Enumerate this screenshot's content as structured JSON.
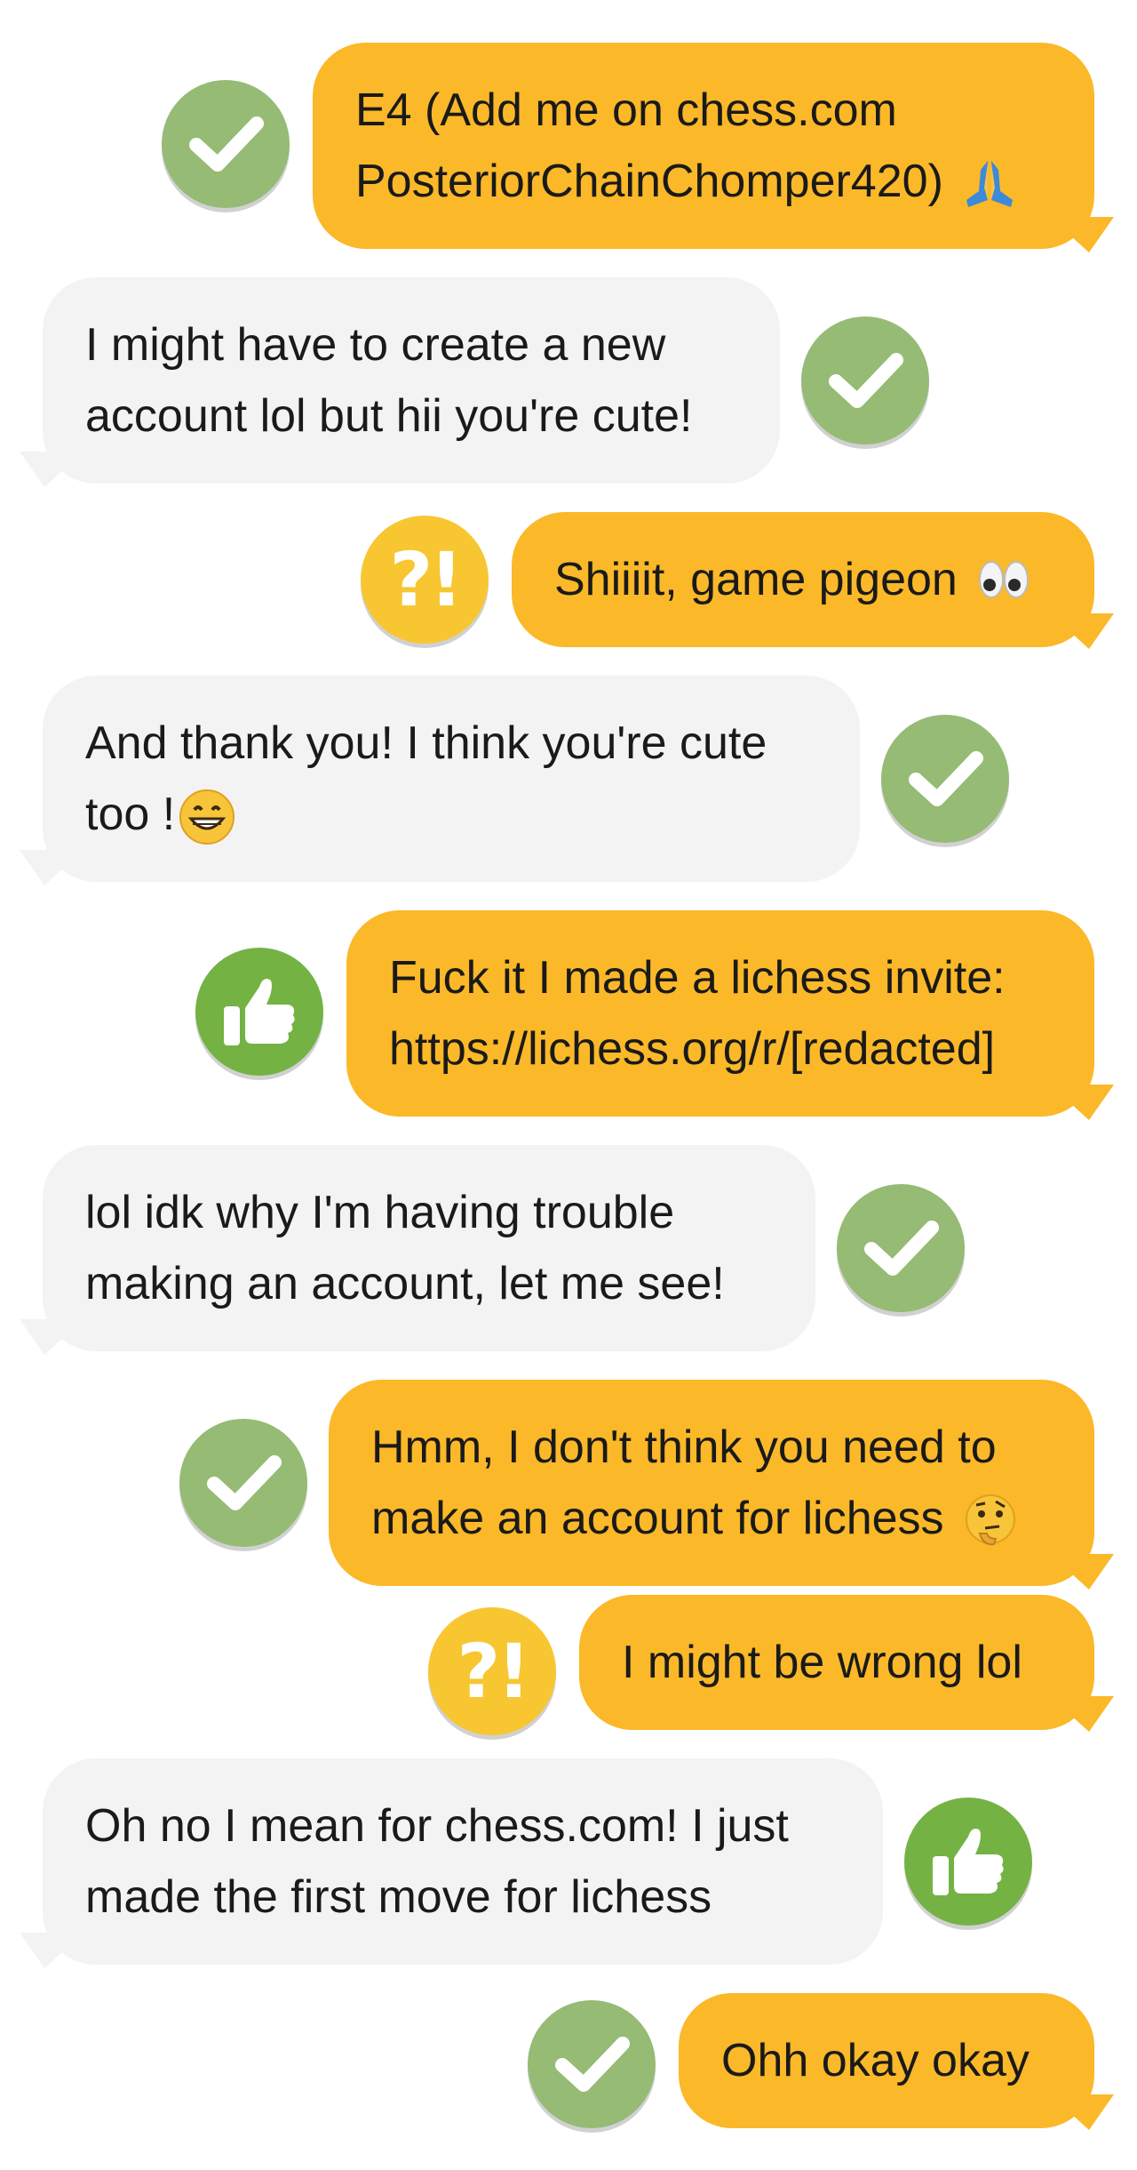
{
  "messages": [
    {
      "side": "out",
      "lines": [
        "E4 (Add me on chess.com",
        "PosteriorChainChomper420)"
      ],
      "emoji": "folded-hands-emoji",
      "badge": "best"
    },
    {
      "side": "in",
      "lines": [
        "I might have to create a new",
        "account lol but hii you're cute!"
      ],
      "badge": "best"
    },
    {
      "side": "out",
      "lines": [
        "Shiiiit, game pigeon"
      ],
      "emoji": "eyes-emoji",
      "badge": "interesting"
    },
    {
      "side": "in",
      "lines": [
        "And thank you! I think you're cute",
        "too !"
      ],
      "emoji": "grinning-face-emoji",
      "badge": "best"
    },
    {
      "side": "out",
      "lines": [
        "Fuck it I made a lichess invite:",
        "https://lichess.org/r/[redacted]"
      ],
      "badge": "great"
    },
    {
      "side": "in",
      "lines": [
        "lol idk why I'm having trouble",
        "making an account, let me see!"
      ],
      "badge": "best"
    },
    {
      "side": "out",
      "lines": [
        "Hmm, I don't think you need to",
        "make an account for lichess"
      ],
      "emoji": "thinking-face-emoji",
      "badge": "best"
    },
    {
      "side": "out",
      "lines": [
        "I might be wrong lol"
      ],
      "badge": "interesting"
    },
    {
      "side": "in",
      "lines": [
        "Oh no I mean for chess.com! I just",
        "made the first move for lichess"
      ],
      "badge": "great"
    },
    {
      "side": "out",
      "lines": [
        "Ohh okay okay"
      ],
      "badge": "best"
    }
  ],
  "badge_labels": {
    "interesting": "?!"
  },
  "colors": {
    "outgoing_bubble": "#fbb828",
    "incoming_bubble": "#f3f3f3",
    "best_badge": "#95bb74",
    "great_badge": "#74b244",
    "interesting_badge": "#f7c631"
  }
}
